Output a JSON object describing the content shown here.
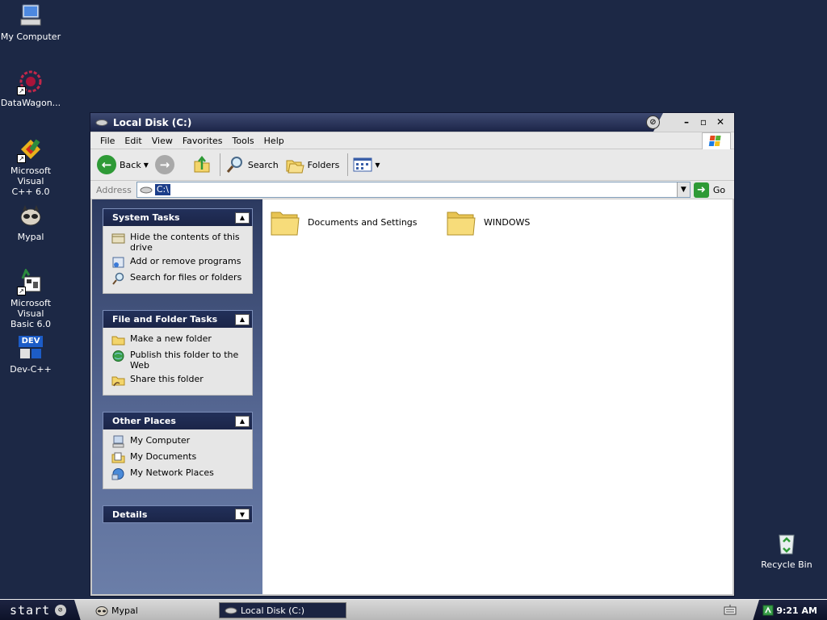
{
  "desktop": {
    "icons": [
      {
        "label": "My Computer"
      },
      {
        "label": "DataWagon..."
      },
      {
        "label": "Microsoft Visual\nC++ 6.0"
      },
      {
        "label": "Mypal"
      },
      {
        "label": "Microsoft Visual\nBasic 6.0"
      },
      {
        "label": "Dev-C++"
      },
      {
        "label": "Recycle Bin"
      }
    ],
    "dev_icon_text": "DEV"
  },
  "window": {
    "title": "Local Disk (C:)",
    "menu": [
      "File",
      "Edit",
      "View",
      "Favorites",
      "Tools",
      "Help"
    ],
    "toolbar": {
      "back": "Back",
      "search": "Search",
      "folders": "Folders"
    },
    "address": {
      "label": "Address",
      "value": "C:\\",
      "go": "Go"
    },
    "panels": [
      {
        "title": "System Tasks",
        "items": [
          {
            "label": "Hide the contents of this drive",
            "icon": "hide-contents-icon"
          },
          {
            "label": "Add or remove programs",
            "icon": "add-remove-programs-icon"
          },
          {
            "label": "Search for files or folders",
            "icon": "search-icon"
          }
        ]
      },
      {
        "title": "File and Folder Tasks",
        "items": [
          {
            "label": "Make a new folder",
            "icon": "new-folder-icon"
          },
          {
            "label": "Publish this folder to the Web",
            "icon": "publish-web-icon"
          },
          {
            "label": "Share this folder",
            "icon": "share-folder-icon"
          }
        ]
      },
      {
        "title": "Other Places",
        "items": [
          {
            "label": "My Computer",
            "icon": "my-computer-icon"
          },
          {
            "label": "My Documents",
            "icon": "my-documents-icon"
          },
          {
            "label": "My Network Places",
            "icon": "network-places-icon"
          }
        ]
      },
      {
        "title": "Details",
        "items": []
      }
    ],
    "folders": [
      {
        "name": "Documents and Settings"
      },
      {
        "name": "WINDOWS"
      }
    ]
  },
  "taskbar": {
    "start_label": "start",
    "tasks": [
      {
        "label": "Mypal"
      },
      {
        "label": "Local Disk (C:)"
      }
    ],
    "clock": "9:21 AM"
  },
  "colors": {
    "desktop": "#1c2845",
    "panel_head": "#1b2548",
    "folder_yellow": "#f3d56b"
  }
}
